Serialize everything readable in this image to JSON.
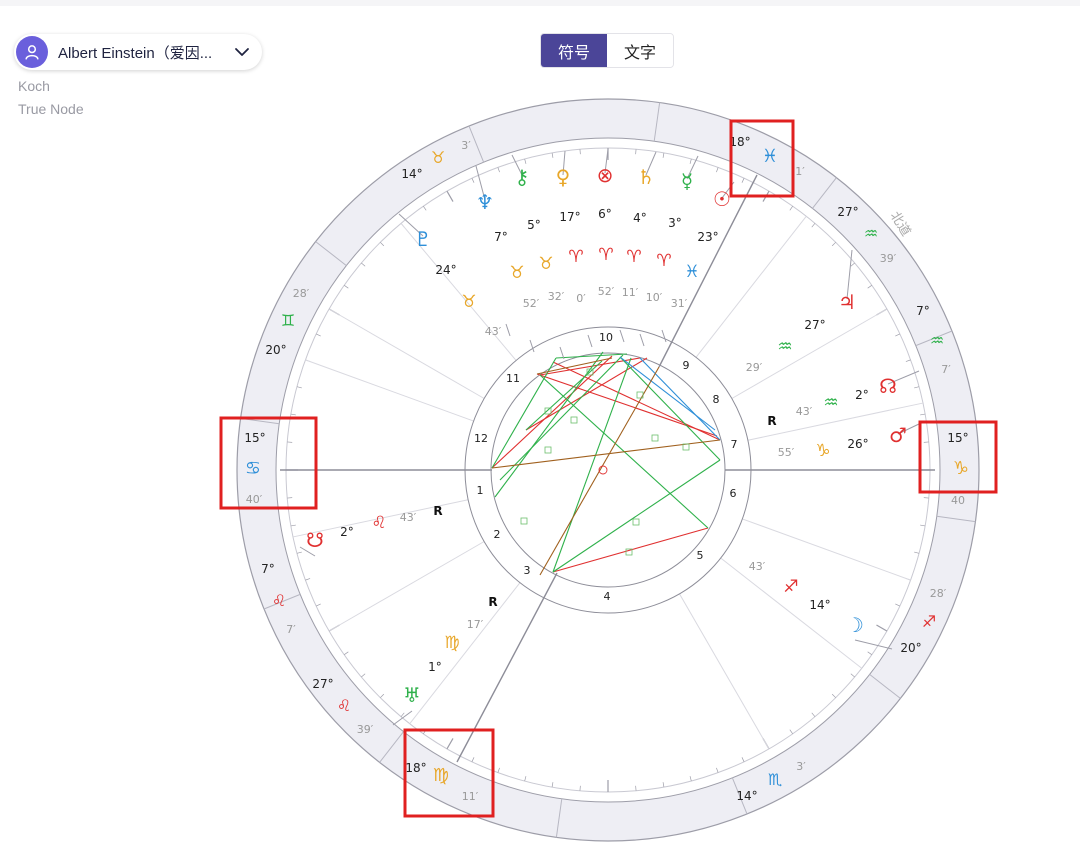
{
  "header": {
    "person_name": "Albert Einstein（爱因...",
    "house_system": "Koch",
    "node_type": "True Node",
    "toggle": {
      "symbols_label": "符号",
      "text_label": "文字",
      "active": "symbols"
    }
  },
  "chart": {
    "houses": [
      "1",
      "2",
      "3",
      "4",
      "5",
      "6",
      "7",
      "8",
      "9",
      "10",
      "11",
      "12"
    ],
    "angles": [
      {
        "name": "ascendant",
        "deg": "15°",
        "glyph": "♋",
        "min": "40′",
        "color": "#2e8fd8"
      },
      {
        "name": "descendant",
        "deg": "15°",
        "glyph": "♑",
        "min": "40",
        "color": "#e8a72a"
      },
      {
        "name": "midheaven",
        "deg": "18°",
        "glyph": "♓",
        "min": "1′",
        "color": "#2e8fd8"
      },
      {
        "name": "imum-coeli",
        "deg": "18°",
        "glyph": "♍",
        "min": "11′",
        "color": "#e8a72a"
      }
    ],
    "cusps": [
      {
        "deg": "14°",
        "glyph": "♉",
        "min": "3′",
        "color": "#e8a72a"
      },
      {
        "deg": "27°",
        "glyph": "♒",
        "min": "39′",
        "color": "#2fb14b"
      },
      {
        "deg": "7°",
        "glyph": "♒",
        "min": "7′",
        "color": "#2fb14b"
      },
      {
        "deg": "28′",
        "glyph": "♐",
        "min": "20°",
        "color": "#e03030"
      },
      {
        "deg": "14°",
        "glyph": "♏",
        "min": "3′",
        "color": "#2e8fd8"
      },
      {
        "deg": "27°",
        "glyph": "♌",
        "min": "39′",
        "color": "#e03030"
      },
      {
        "deg": "7°",
        "glyph": "♌",
        "min": "7′",
        "color": "#e03030"
      },
      {
        "deg": "20°",
        "glyph": "♊",
        "min": "28′",
        "color": "#2fb14b"
      }
    ],
    "planets": [
      {
        "name": "neptune",
        "glyph": "♆",
        "deg": "7°",
        "sign": "♉",
        "min": "52′",
        "color": "#2e8fd8"
      },
      {
        "name": "chiron",
        "glyph": "⚷",
        "deg": "5°",
        "sign": "♉",
        "min": "32′",
        "color": "#2fb14b"
      },
      {
        "name": "venus",
        "glyph": "♀",
        "deg": "17°",
        "sign": "♈",
        "min": "0′",
        "color": "#e8a72a"
      },
      {
        "name": "part-of-fortune",
        "glyph": "⊗",
        "deg": "6°",
        "sign": "♈",
        "min": "52′",
        "color": "#e03030"
      },
      {
        "name": "saturn",
        "glyph": "♄",
        "deg": "4°",
        "sign": "♈",
        "min": "11′",
        "color": "#e8a72a"
      },
      {
        "name": "mercury",
        "glyph": "☿",
        "deg": "3°",
        "sign": "♈",
        "min": "10′",
        "color": "#2fb14b"
      },
      {
        "name": "sun",
        "glyph": "☉",
        "deg": "23°",
        "sign": "♓",
        "min": "31′",
        "color": "#e03030"
      },
      {
        "name": "pluto",
        "glyph": "♇",
        "deg": "24°",
        "sign": "♉",
        "min": "43′",
        "color": "#2e8fd8"
      },
      {
        "name": "jupiter",
        "glyph": "♃",
        "deg": "27°",
        "sign": "♒",
        "min": "29′",
        "color": "#e03030"
      },
      {
        "name": "north-node",
        "glyph": "☊",
        "deg": "2°",
        "sign": "♒",
        "min": "43′",
        "color": "#e03030"
      },
      {
        "name": "mars",
        "glyph": "♂",
        "deg": "26°",
        "sign": "♑",
        "min": "55′",
        "color": "#e03030"
      },
      {
        "name": "moon",
        "glyph": "☽",
        "deg": "14°",
        "sign": "♐",
        "min": "43′",
        "color": "#2e8fd8"
      },
      {
        "name": "uranus",
        "glyph": "♅",
        "deg": "1°",
        "sign": "♍",
        "min": "17′",
        "color": "#2fb14b"
      },
      {
        "name": "south-node",
        "glyph": "☋",
        "deg": "2°",
        "sign": "♌",
        "min": "43′",
        "color": "#e03030"
      }
    ],
    "retrograde_marker": "R",
    "retrogrades": [
      "north-node",
      "south-node",
      "uranus"
    ],
    "midheaven_side_label": "北道"
  }
}
